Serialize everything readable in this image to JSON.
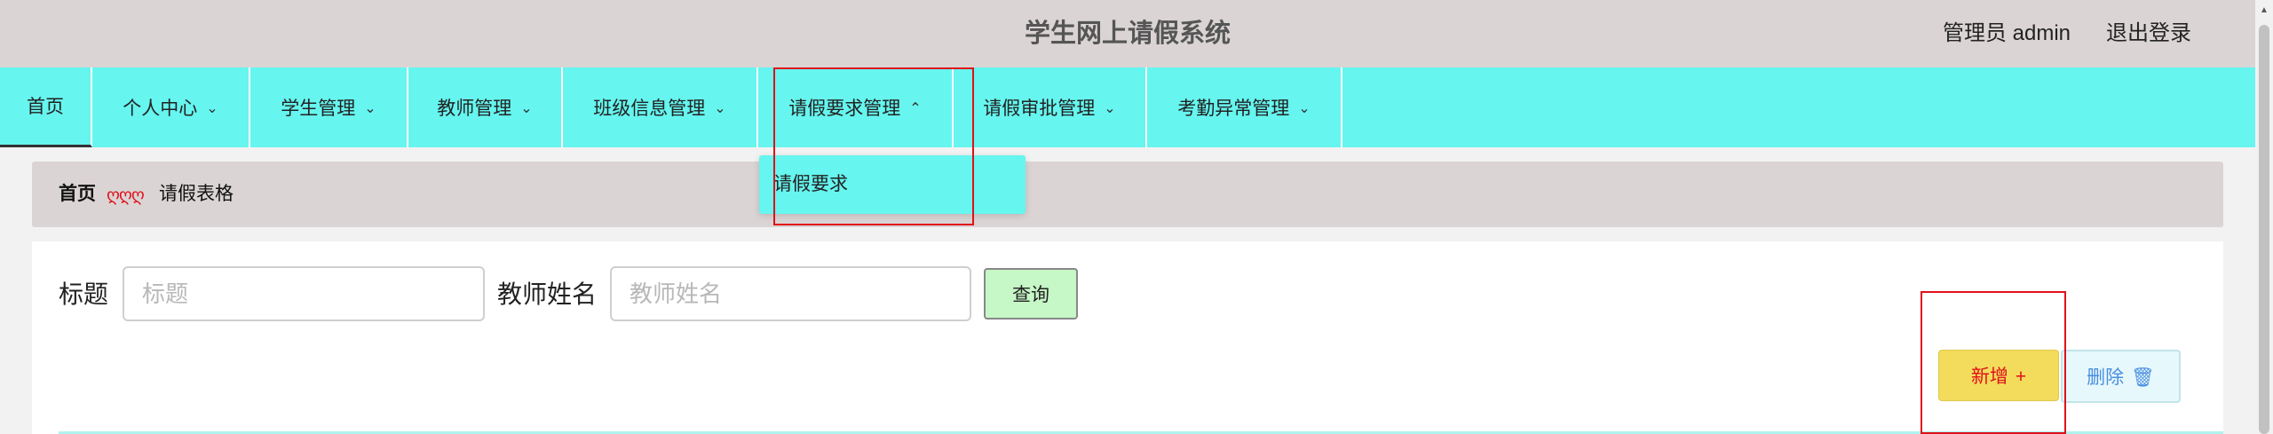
{
  "header": {
    "title": "学生网上请假系统",
    "user": "管理员 admin",
    "logout": "退出登录"
  },
  "nav": {
    "home": "首页",
    "items": [
      {
        "label": "个人中心",
        "chevron": "⌄"
      },
      {
        "label": "学生管理",
        "chevron": "⌄"
      },
      {
        "label": "教师管理",
        "chevron": "⌄"
      },
      {
        "label": "班级信息管理",
        "chevron": "⌄"
      },
      {
        "label": "请假要求管理",
        "chevron": "⌃"
      },
      {
        "label": "请假审批管理",
        "chevron": "⌄"
      },
      {
        "label": "考勤异常管理",
        "chevron": "⌄"
      }
    ],
    "dropdown_item": "请假要求"
  },
  "breadcrumb": {
    "home": "首页",
    "separator": "ღღღ",
    "current": "请假表格"
  },
  "search": {
    "title_label": "标题",
    "title_placeholder": "标题",
    "teacher_label": "教师姓名",
    "teacher_placeholder": "教师姓名",
    "query_button": "查询"
  },
  "actions": {
    "add_label": "新增",
    "add_icon": "+",
    "delete_label": "删除",
    "delete_icon": "🗑"
  },
  "colors": {
    "nav_bg": "#66f5ef",
    "header_bg": "#dbd4d4",
    "highlight_border": "#e0101a",
    "add_button": "#f3dc5c",
    "query_button": "#c6f7c6"
  }
}
